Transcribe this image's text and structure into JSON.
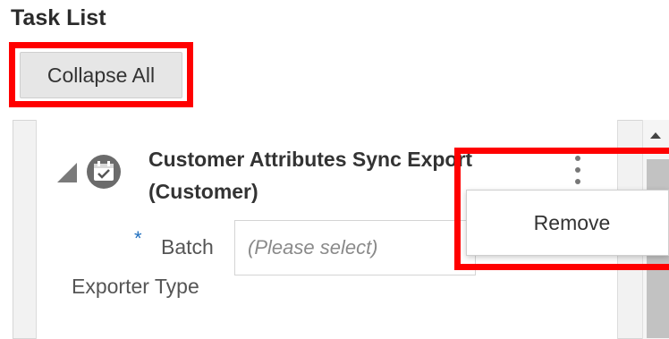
{
  "section": {
    "title": "Task List"
  },
  "toolbar": {
    "collapse_all_label": "Collapse All"
  },
  "task": {
    "name": "Customer Attributes Sync Export (Customer)",
    "field": {
      "required_marker": "*",
      "label_line1": "Batch",
      "label_line2": "Exporter Type",
      "placeholder": "(Please select)"
    }
  },
  "context_menu": {
    "items": [
      {
        "label": "Remove"
      }
    ]
  },
  "icons": {
    "expand": "triangle-expanded-icon",
    "task": "calendar-task-icon",
    "more": "kebab-menu-icon",
    "scroll_up": "chevron-up-icon"
  },
  "colors": {
    "highlight": "#ff0000",
    "required": "#1f6fbf"
  }
}
